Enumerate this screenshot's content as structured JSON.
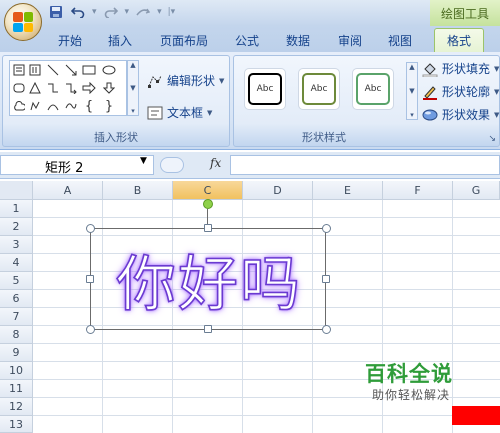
{
  "titlebar": {
    "context_title": "绘图工具",
    "qat": [
      {
        "icon": "save-icon"
      },
      {
        "icon": "undo-icon"
      },
      {
        "icon": "redo-icon"
      },
      {
        "icon": "repeat-icon"
      },
      {
        "icon": "customize-qat-icon"
      }
    ]
  },
  "tabs": [
    {
      "label": "开始"
    },
    {
      "label": "插入"
    },
    {
      "label": "页面布局"
    },
    {
      "label": "公式"
    },
    {
      "label": "数据"
    },
    {
      "label": "审阅"
    },
    {
      "label": "视图"
    },
    {
      "label": "格式"
    }
  ],
  "ribbon": {
    "insert_shapes": {
      "label": "插入形状",
      "edit_shape": "编辑形状",
      "text_box": "文本框"
    },
    "shape_styles": {
      "label": "形状样式",
      "thumb_text": "Abc",
      "fill": "形状填充",
      "outline": "形状轮廓",
      "effects": "形状效果"
    }
  },
  "formula_bar": {
    "name_box": "矩形  2",
    "fx": "fx",
    "content": ""
  },
  "sheet": {
    "columns": [
      "A",
      "B",
      "C",
      "D",
      "E",
      "F",
      "G"
    ],
    "rows": [
      "1",
      "2",
      "3",
      "4",
      "5",
      "6",
      "7",
      "8",
      "9",
      "10",
      "11",
      "12",
      "13"
    ],
    "selected_column": "C"
  },
  "shape": {
    "text": "你好吗",
    "glow_color": "#b07bff",
    "outline_color": "#6a3ad0"
  },
  "watermark": {
    "title": "百科全说",
    "subtitle": "助你轻松解决"
  },
  "colors": {
    "ribbon_bg": "#dfe9f5",
    "context_tab": "#c5e29d",
    "watermark_green": "#2f9c3a",
    "red_block": "#ff0000"
  }
}
